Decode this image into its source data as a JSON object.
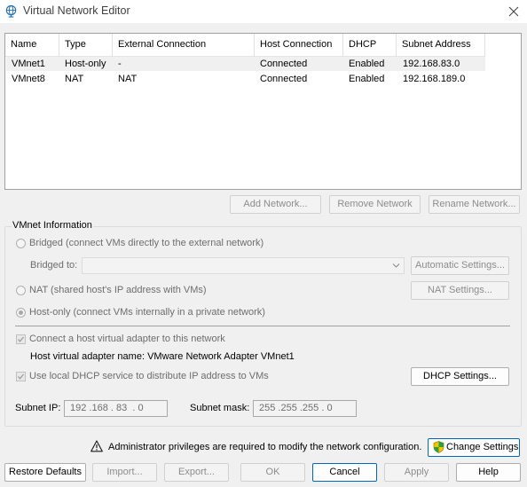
{
  "window": {
    "title": "Virtual Network Editor"
  },
  "table": {
    "columns": [
      "Name",
      "Type",
      "External Connection",
      "Host Connection",
      "DHCP",
      "Subnet Address"
    ],
    "rows": [
      [
        "VMnet1",
        "Host-only",
        "-",
        "Connected",
        "Enabled",
        "192.168.83.0"
      ],
      [
        "VMnet8",
        "NAT",
        "NAT",
        "Connected",
        "Enabled",
        "192.168.189.0"
      ]
    ],
    "selected_row": 0
  },
  "network_buttons": {
    "add": "Add Network...",
    "remove": "Remove Network",
    "rename": "Rename Network..."
  },
  "vmnet_info": {
    "legend": "VMnet Information",
    "bridged_label": "Bridged (connect VMs directly to the external network)",
    "bridged_to_label": "Bridged to:",
    "bridged_to_value": "",
    "automatic_settings": "Automatic Settings...",
    "nat_label": "NAT (shared host's IP address with VMs)",
    "nat_settings": "NAT Settings...",
    "hostonly_label": "Host-only (connect VMs internally in a private network)",
    "connect_adapter_label": "Connect a host virtual adapter to this network",
    "adapter_name_label": "Host virtual adapter name: VMware Network Adapter VMnet1",
    "dhcp_label": "Use local DHCP service to distribute IP address to VMs",
    "dhcp_settings": "DHCP Settings...",
    "subnet_ip_label": "Subnet IP:",
    "subnet_ip_value": "192 .168 . 83  . 0",
    "subnet_mask_label": "Subnet mask:",
    "subnet_mask_value": "255 .255 .255 . 0"
  },
  "admin": {
    "message": "Administrator privileges are required to modify the network configuration.",
    "change_settings": "Change Settings"
  },
  "footer": {
    "restore": "Restore Defaults",
    "import": "Import...",
    "export": "Export...",
    "ok": "OK",
    "cancel": "Cancel",
    "apply": "Apply",
    "help": "Help"
  },
  "colors": {
    "accent": "#0067c0",
    "shield_yellow": "#f5c400",
    "shield_green": "#2e9e3e"
  }
}
